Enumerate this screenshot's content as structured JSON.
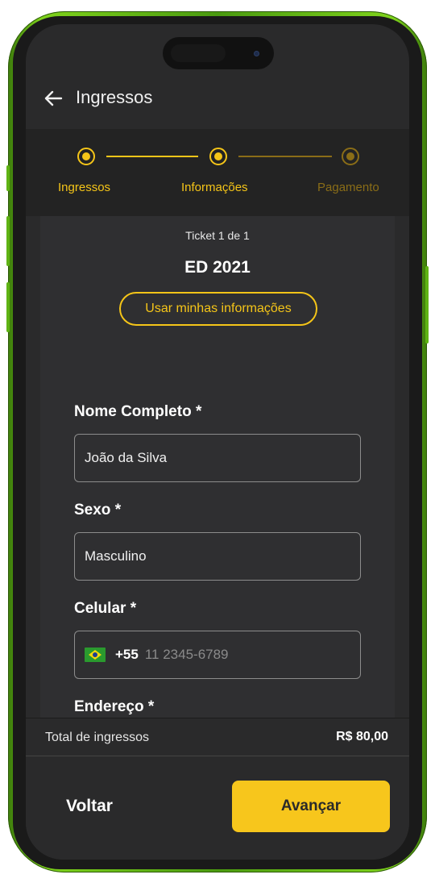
{
  "header": {
    "title": "Ingressos"
  },
  "stepper": {
    "steps": [
      {
        "label": "Ingressos",
        "state": "done"
      },
      {
        "label": "Informações",
        "state": "current"
      },
      {
        "label": "Pagamento",
        "state": "pending"
      }
    ]
  },
  "form": {
    "ticket_count": "Ticket 1 de 1",
    "event_name": "ED 2021",
    "use_info_label": "Usar minhas informações",
    "fields": [
      {
        "label": "Nome Completo *",
        "value": "João da Silva"
      },
      {
        "label": "Sexo *",
        "value": "Masculino"
      },
      {
        "label": "Celular *",
        "dial_code": "+55",
        "placeholder": "11 2345-6789",
        "flag_icon": "brazil-flag-icon"
      },
      {
        "label": "Endereço *",
        "value": ""
      }
    ]
  },
  "summary": {
    "total_label": "Total de ingressos",
    "total_value": "R$ 80,00"
  },
  "footer": {
    "back_label": "Voltar",
    "next_label": "Avançar"
  },
  "colors": {
    "accent": "#f5c518",
    "accent_dim": "#8a6d17",
    "background": "#2a2a2b",
    "frame": "#5fb315"
  }
}
